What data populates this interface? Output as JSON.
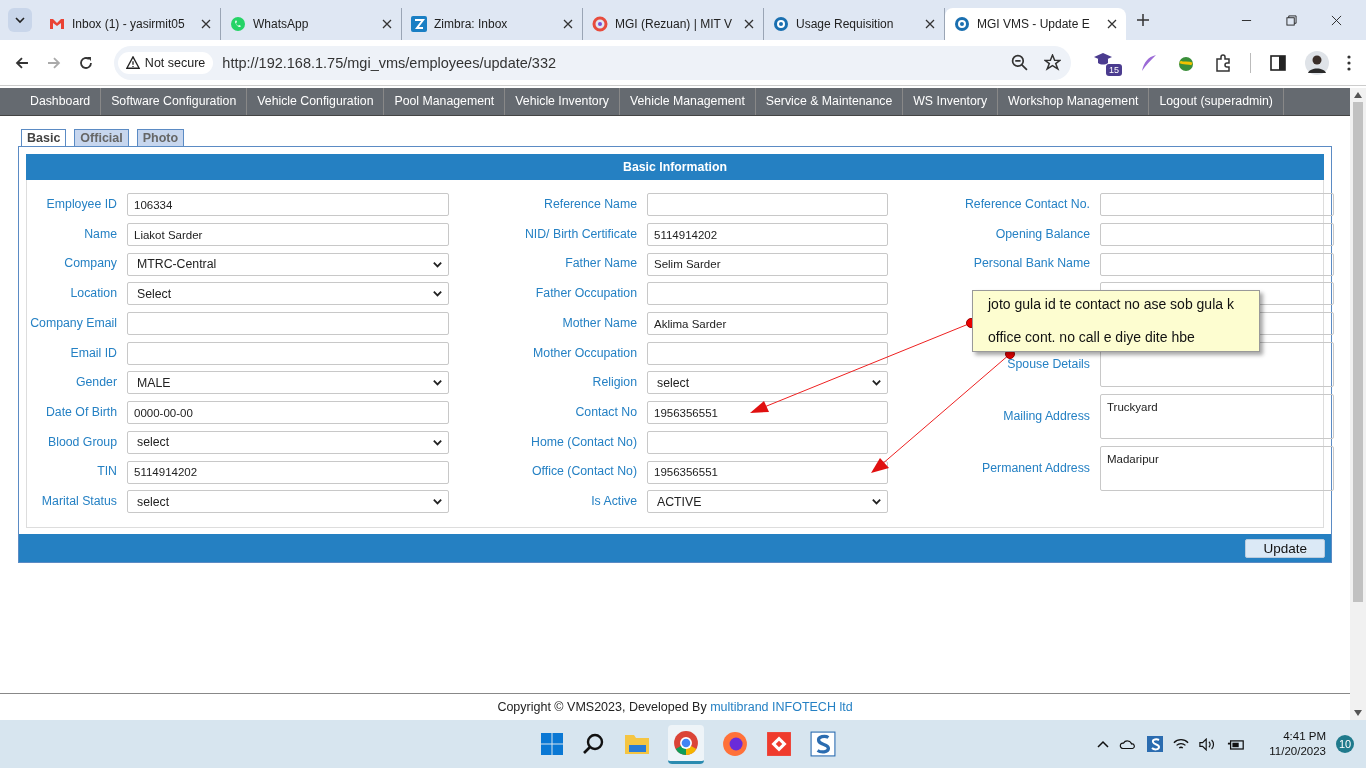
{
  "browser": {
    "tabs": [
      {
        "title": "Inbox (1) - yasirmit05",
        "selected": false
      },
      {
        "title": "WhatsApp",
        "selected": false
      },
      {
        "title": "Zimbra: Inbox",
        "selected": false
      },
      {
        "title": "MGI (Rezuan) | MIT V",
        "selected": false
      },
      {
        "title": "Usage Requisition",
        "selected": false
      },
      {
        "title": "MGI VMS - Update E",
        "selected": true
      }
    ],
    "security": "Not secure",
    "url": "http://192.168.1.75/mgi_vms/employees/update/332",
    "extension_badge": "15"
  },
  "nav": [
    "Dashboard",
    "Software Configuration",
    "Vehicle Configuration",
    "Pool Management",
    "Vehicle Inventory",
    "Vehicle Management",
    "Service & Maintenance",
    "WS Inventory",
    "Workshop Management",
    "Logout (superadmin)"
  ],
  "form_tabs": [
    {
      "label": "Basic",
      "selected": true
    },
    {
      "label": "Official",
      "selected": false
    },
    {
      "label": "Photo",
      "selected": false
    }
  ],
  "panel_title": "Basic Information",
  "columns": [
    [
      {
        "label": "Employee ID",
        "kind": "text",
        "value": "106334"
      },
      {
        "label": "Name",
        "kind": "text",
        "value": "Liakot Sarder"
      },
      {
        "label": "Company",
        "kind": "select",
        "value": "MTRC-Central"
      },
      {
        "label": "Location",
        "kind": "select",
        "value": "Select"
      },
      {
        "label": "Company Email",
        "kind": "text"
      },
      {
        "label": "Email ID",
        "kind": "text"
      },
      {
        "label": "Gender",
        "kind": "select",
        "value": "MALE"
      },
      {
        "label": "Date Of Birth",
        "kind": "text",
        "value": "0000-00-00"
      },
      {
        "label": "Blood Group",
        "kind": "select",
        "value": "select"
      },
      {
        "label": "TIN",
        "kind": "text",
        "value": "5114914202"
      },
      {
        "label": "Marital Status",
        "kind": "select",
        "value": "select"
      }
    ],
    [
      {
        "label": "Reference Name",
        "kind": "text"
      },
      {
        "label": "NID/ Birth Certificate",
        "kind": "text",
        "value": "5114914202"
      },
      {
        "label": "Father Name",
        "kind": "text",
        "value": "Selim Sarder"
      },
      {
        "label": "Father Occupation",
        "kind": "text"
      },
      {
        "label": "Mother Name",
        "kind": "text",
        "value": "Aklima Sarder"
      },
      {
        "label": "Mother Occupation",
        "kind": "text"
      },
      {
        "label": "Religion",
        "kind": "select",
        "value": "select"
      },
      {
        "label": "Contact No",
        "kind": "text",
        "value": "1956356551"
      },
      {
        "label": "Home (Contact No)",
        "kind": "text"
      },
      {
        "label": "Office (Contact No)",
        "kind": "text",
        "value": "1956356551"
      },
      {
        "label": "Is Active",
        "kind": "select",
        "value": "ACTIVE"
      }
    ],
    [
      {
        "label": "Reference Contact No.",
        "kind": "text"
      },
      {
        "label": "Opening Balance",
        "kind": "text"
      },
      {
        "label": "Personal Bank Name",
        "kind": "text"
      },
      {
        "kind": "text"
      },
      {
        "kind": "text"
      },
      {
        "label": "Spouse Details",
        "kind": "textarea"
      },
      {
        "label": "Mailing Address",
        "kind": "textarea",
        "value": "Truckyard"
      },
      {
        "label": "Permanent Address",
        "kind": "textarea",
        "value": "Madaripur"
      }
    ]
  ],
  "update_button": "Update",
  "note": [
    "joto gula id te contact no ase sob gula k",
    "office cont. no call e diye dite hbe"
  ],
  "footer": {
    "text": "Copyright © VMS2023, Developed By ",
    "link": "multibrand INFOTECH ltd"
  },
  "taskbar": {
    "time": "4:41 PM",
    "date": "11/20/2023",
    "notifications": "10"
  }
}
